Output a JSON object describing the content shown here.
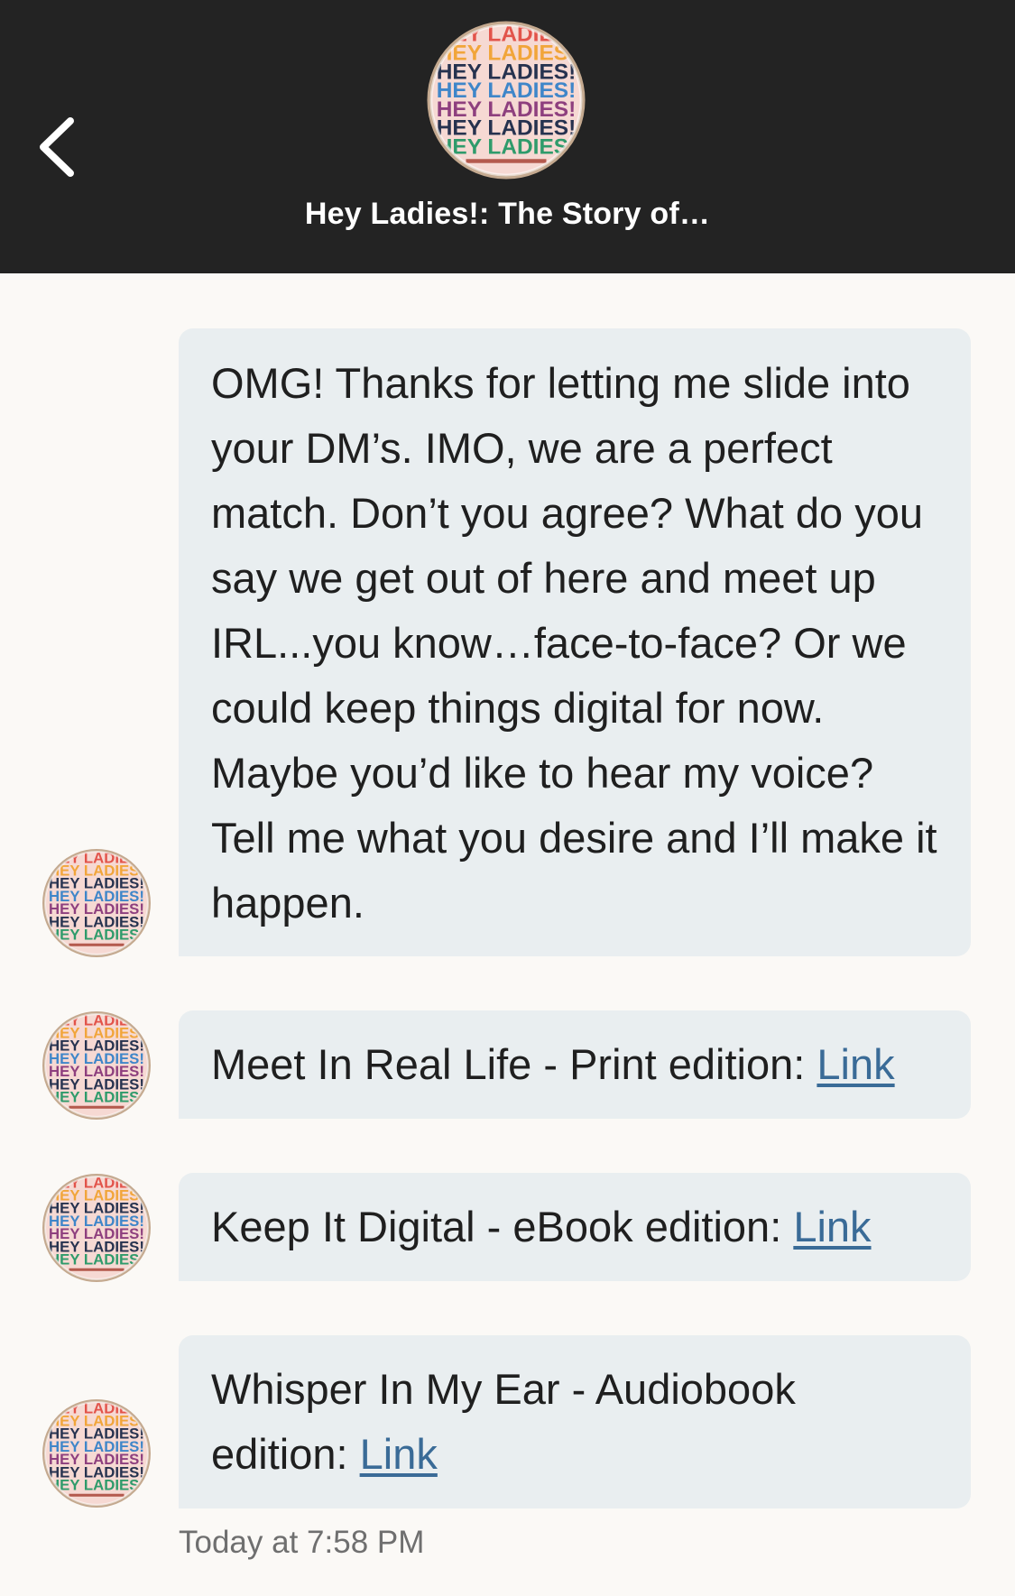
{
  "header": {
    "back_icon": "chevron-left-icon",
    "title": "Hey Ladies!: The Story of…",
    "avatar_text": "HEY LADIES!"
  },
  "messages": [
    {
      "text": "OMG! Thanks for letting me slide into your DM’s. IMO, we are a perfect match. Don’t you agree? What do you say we get out of here and meet up IRL...you know…face-to-face? Or we could keep things digital for now. Maybe you’d like to hear my voice? Tell me what you desire and I’ll make it happen."
    },
    {
      "prefix": "Meet In Real Life - Print edition: ",
      "link_label": "Link"
    },
    {
      "prefix": "Keep It Digital - eBook edition: ",
      "link_label": "Link"
    },
    {
      "prefix": "Whisper In My Ear - Audiobook edition: ",
      "link_label": "Link"
    }
  ],
  "timestamp": "Today at 7:58 PM",
  "colors": {
    "header_bg": "#232323",
    "bubble_bg": "#e9eef0",
    "link": "#3a6b97",
    "page_bg": "#fbf9f6"
  }
}
